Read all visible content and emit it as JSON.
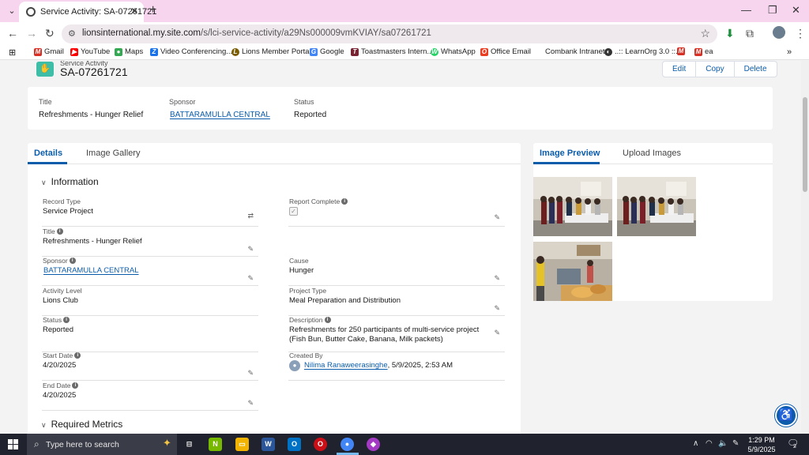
{
  "browser": {
    "tab_title": "Service Activity: SA-07261721",
    "url_host": "lionsinternational.my.site.com",
    "url_path": "/s/lci-service-activity/a29Ns000009vmKVIAY/sa07261721",
    "bookmarks": [
      {
        "label": "Gmail",
        "icon": "gmail-icon",
        "color": "#d93025"
      },
      {
        "label": "YouTube",
        "icon": "youtube-icon",
        "color": "#ff0000"
      },
      {
        "label": "Maps",
        "icon": "maps-icon",
        "color": "#34a853"
      },
      {
        "label": "Video Conferencing...",
        "icon": "video-icon",
        "color": "#1a73e8"
      },
      {
        "label": "Lions Member Portal",
        "icon": "lions-icon",
        "color": "#7a5d00"
      },
      {
        "label": "Google",
        "icon": "google-icon",
        "color": "#4285f4"
      },
      {
        "label": "Toastmasters Intern...",
        "icon": "toastmasters-icon",
        "color": "#772432"
      },
      {
        "label": "WhatsApp",
        "icon": "whatsapp-icon",
        "color": "#25d366"
      },
      {
        "label": "Office Email",
        "icon": "office-icon",
        "color": "#ea3e23"
      },
      {
        "label": "Combank Intranet",
        "icon": "",
        "color": ""
      },
      {
        "label": "..:: LearnOrg 3.0 ::...",
        "icon": "learnorg-icon",
        "color": "#333333"
      },
      {
        "label": "",
        "icon": "gmail-icon",
        "color": "#d93025"
      },
      {
        "label": "ea",
        "icon": "gmail-icon",
        "color": "#d93025"
      }
    ]
  },
  "record": {
    "type_label": "Service Activity",
    "name": "SA-07261721",
    "actions": [
      "Edit",
      "Copy",
      "Delete"
    ]
  },
  "highlights": [
    {
      "label": "Title",
      "value": "Refreshments - Hunger Relief",
      "link": false
    },
    {
      "label": "Sponsor",
      "value": "BATTARAMULLA CENTRAL",
      "link": true
    },
    {
      "label": "Status",
      "value": "Reported",
      "link": false
    }
  ],
  "detail_tabs": [
    "Details",
    "Image Gallery"
  ],
  "sections": {
    "information": "Information",
    "required_metrics": "Required Metrics"
  },
  "fields_left": [
    {
      "label": "Record Type",
      "value": "Service Project",
      "info": false
    },
    {
      "label": "Title",
      "value": "Refreshments - Hunger Relief",
      "info": true
    },
    {
      "label": "Sponsor",
      "value": "BATTARAMULLA CENTRAL",
      "info": true
    },
    {
      "label": "Activity Level",
      "value": "Lions Club",
      "info": false
    },
    {
      "label": "Status",
      "value": "Reported",
      "info": true
    },
    {
      "label": "Start Date",
      "value": "4/20/2025",
      "info": true
    },
    {
      "label": "End Date",
      "value": "4/20/2025",
      "info": true
    }
  ],
  "fields_right": [
    {
      "label": "Report Complete",
      "value": "",
      "info": true
    },
    {
      "label": "Cause",
      "value": "Hunger",
      "info": false
    },
    {
      "label": "Project Type",
      "value": "Meal Preparation and Distribution",
      "info": false
    },
    {
      "label": "Description",
      "value": "Refreshments for 250 participants of multi-service project (Fish Bun, Butter Cake, Banana, Milk packets)",
      "info": true
    },
    {
      "label": "Created By",
      "value": "Nilima Ranaweerasinghe",
      "value_suffix": ", 5/9/2025, 2:53 AM",
      "info": false
    }
  ],
  "image_tabs": [
    "Image Preview",
    "Upload Images"
  ],
  "taskbar": {
    "search_placeholder": "Type here to search",
    "time": "1:29 PM",
    "date": "5/9/2025",
    "notifications": "2"
  }
}
